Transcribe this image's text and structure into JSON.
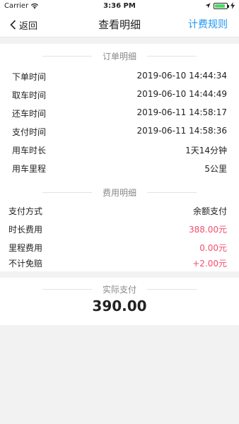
{
  "status_bar": {
    "carrier": "Carrier",
    "time": "3:36 PM",
    "battery_level": 0.85,
    "battery_color": "#4cd964"
  },
  "nav": {
    "back_label": "返回",
    "title": "查看明细",
    "right_label": "计费规则",
    "accent": "#2196f3"
  },
  "order_section": {
    "title": "订单明细",
    "rows": [
      {
        "label": "下单时间",
        "value": "2019-06-10 14:44:34"
      },
      {
        "label": "取车时间",
        "value": "2019-06-10 14:44:49"
      },
      {
        "label": "还车时间",
        "value": "2019-06-11 14:58:17"
      },
      {
        "label": "支付时间",
        "value": "2019-06-11 14:58:36"
      },
      {
        "label": "用车时长",
        "value": "1天14分钟"
      },
      {
        "label": "用车里程",
        "value": "5公里"
      }
    ]
  },
  "fee_section": {
    "title": "费用明细",
    "rows": [
      {
        "label": "支付方式",
        "value": "余额支付",
        "color": "#222222"
      },
      {
        "label": "时长费用",
        "value": "388.00元",
        "color": "#f0506e"
      },
      {
        "label": "里程费用",
        "value": "0.00元",
        "color": "#f0506e"
      },
      {
        "label": "不计免赔",
        "value": "+2.00元",
        "color": "#f0506e"
      }
    ]
  },
  "total_section": {
    "title": "实际支付",
    "amount": "390.00"
  }
}
